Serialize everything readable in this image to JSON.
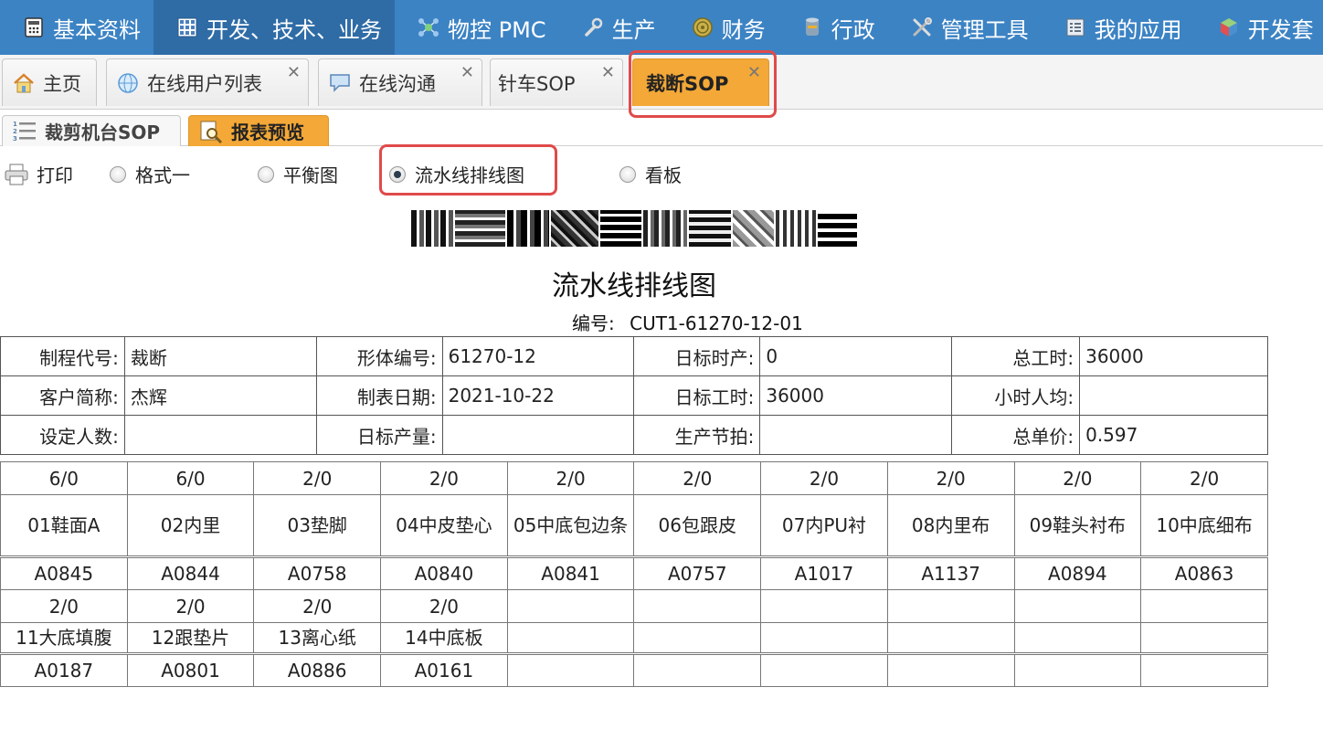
{
  "nav": {
    "items": [
      {
        "label": "基本资料",
        "icon": "calculator-icon"
      },
      {
        "label": "开发、技术、业务",
        "icon": "grid-icon"
      },
      {
        "label": "物控 PMC",
        "icon": "network-icon"
      },
      {
        "label": "生产",
        "icon": "wrench-icon"
      },
      {
        "label": "财务",
        "icon": "coin-icon"
      },
      {
        "label": "行政",
        "icon": "database-icon"
      },
      {
        "label": "管理工具",
        "icon": "tools-icon"
      },
      {
        "label": "我的应用",
        "icon": "list-icon"
      },
      {
        "label": "开发套",
        "icon": "cube-icon"
      }
    ]
  },
  "tabs": [
    {
      "label": "主页",
      "closable": false
    },
    {
      "label": "在线用户列表",
      "closable": true
    },
    {
      "label": "在线沟通",
      "closable": true
    },
    {
      "label": "针车SOP",
      "closable": true
    },
    {
      "label": "裁断SOP",
      "closable": true
    }
  ],
  "close_glyph": "✕",
  "subtabs": [
    {
      "label": "裁剪机台SOP"
    },
    {
      "label": "报表预览"
    }
  ],
  "toolbar": {
    "print": "打印",
    "options": [
      {
        "label": "格式一",
        "checked": false
      },
      {
        "label": "平衡图",
        "checked": false
      },
      {
        "label": "流水线排线图",
        "checked": true
      },
      {
        "label": "看板",
        "checked": false
      }
    ]
  },
  "report": {
    "title": "流水线排线图",
    "code_label": "编号:",
    "code": "CUT1-61270-12-01",
    "info": [
      [
        {
          "label": "制程代号:",
          "value": "裁断"
        },
        {
          "label": "形体编号:",
          "value": "61270-12"
        },
        {
          "label": "日标时产:",
          "value": "0"
        },
        {
          "label": "总工时:",
          "value": "36000"
        }
      ],
      [
        {
          "label": "客户简称:",
          "value": "杰辉"
        },
        {
          "label": "制表日期:",
          "value": "2021-10-22"
        },
        {
          "label": "日标工时:",
          "value": "36000"
        },
        {
          "label": "小时人均:",
          "value": ""
        }
      ],
      [
        {
          "label": "设定人数:",
          "value": ""
        },
        {
          "label": "日标产量:",
          "value": ""
        },
        {
          "label": "生产节拍:",
          "value": ""
        },
        {
          "label": "总单价:",
          "value": "0.597"
        }
      ]
    ],
    "grid_row1": {
      "ratios": [
        "6/0",
        "6/0",
        "2/0",
        "2/0",
        "2/0",
        "2/0",
        "2/0",
        "2/0",
        "2/0",
        "2/0"
      ],
      "names": [
        "01鞋面A",
        "02内里",
        "03垫脚",
        "04中皮垫心",
        "05中底包边条",
        "06包跟皮",
        "07内PU衬",
        "08内里布",
        "09鞋头衬布",
        "10中底细布"
      ],
      "codes": [
        "A0845",
        "A0844",
        "A0758",
        "A0840",
        "A0841",
        "A0757",
        "A1017",
        "A1137",
        "A0894",
        "A0863"
      ]
    },
    "grid_row2": {
      "ratios": [
        "2/0",
        "2/0",
        "2/0",
        "2/0",
        "",
        "",
        "",
        "",
        "",
        ""
      ],
      "names": [
        "11大底填腹",
        "12跟垫片",
        "13离心纸",
        "14中底板",
        "",
        "",
        "",
        "",
        "",
        ""
      ],
      "codes": [
        "A0187",
        "A0801",
        "A0886",
        "A0161",
        "",
        "",
        "",
        "",
        "",
        ""
      ]
    }
  }
}
